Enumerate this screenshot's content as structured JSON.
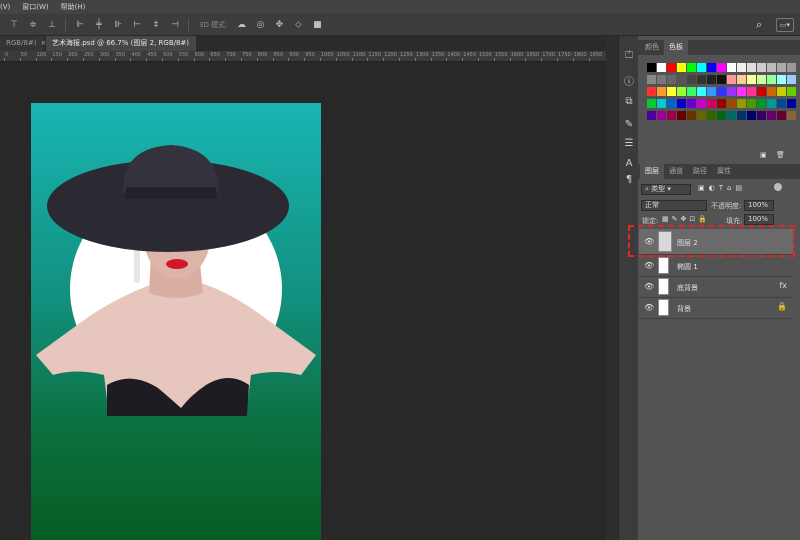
{
  "menu": {
    "items": [
      "(V)",
      "窗口(W)",
      "帮助(H)"
    ]
  },
  "options_bar": {
    "mode_3d_label": "3D 模式:",
    "icons": [
      "align-top-icon",
      "align-vcenter-icon",
      "align-bottom-icon",
      "distribute-top-icon",
      "distribute-vcenter-icon",
      "distribute-bottom-icon",
      "align-left-icon",
      "align-hcenter-icon",
      "align-right-icon",
      "orbit-3d-icon",
      "roll-3d-icon",
      "drag-3d-icon",
      "slide-3d-icon",
      "scale-3d-icon"
    ]
  },
  "tabs": [
    {
      "label": "RGB/8#)",
      "close": "×"
    },
    {
      "label": "艺术海报.psd @ 66.7% (图层 2, RGB/8#) *",
      "close": "×"
    }
  ],
  "ruler": {
    "labels": [
      "0",
      "50",
      "100",
      "150",
      "200",
      "250",
      "300",
      "350",
      "400",
      "450",
      "500",
      "550",
      "600",
      "650",
      "700",
      "750",
      "800",
      "850",
      "900",
      "950",
      "1000",
      "1050",
      "1100",
      "1150",
      "1200",
      "1250",
      "1300",
      "1350",
      "1400",
      "1450",
      "1500",
      "1550",
      "1600",
      "1650",
      "1700",
      "1750",
      "1800",
      "1850"
    ]
  },
  "panels": {
    "color_tabs": [
      "颜色",
      "色板"
    ],
    "layer_tabs": [
      "图层",
      "通道",
      "路径",
      "属性"
    ],
    "filter_kind": "类型",
    "blend_mode": "正常",
    "opacity_label": "不透明度:",
    "opacity_value": "100%",
    "lock_label": "锁定:",
    "fill_label": "填充:",
    "fill_value": "100%"
  },
  "swatch_colors": [
    [
      "#000000",
      "#ffffff",
      "#ff0000",
      "#ffff00",
      "#00ff00",
      "#00ffff",
      "#0000ff",
      "#ff00ff",
      "#ffffff",
      "#eeeeee",
      "#dddddd",
      "#cccccc",
      "#bbbbbb",
      "#aaaaaa",
      "#999999"
    ],
    [
      "#888888",
      "#777777",
      "#666666",
      "#555555",
      "#444444",
      "#333333",
      "#222222",
      "#111111",
      "#ff9999",
      "#ffcc99",
      "#ffff99",
      "#ccff99",
      "#99ff99",
      "#99ffff",
      "#99ccff"
    ],
    [
      "#ff3333",
      "#ff9933",
      "#ffff33",
      "#99ff33",
      "#33ff66",
      "#33ffff",
      "#3399ff",
      "#3333ff",
      "#9933ff",
      "#ff33ff",
      "#ff3399",
      "#cc0000",
      "#cc6600",
      "#cccc00",
      "#66cc00"
    ],
    [
      "#00cc33",
      "#00cccc",
      "#0066cc",
      "#0000cc",
      "#6600cc",
      "#cc00cc",
      "#cc0066",
      "#990000",
      "#994c00",
      "#999900",
      "#4c9900",
      "#009926",
      "#009999",
      "#004c99",
      "#000099"
    ],
    [
      "#4c0099",
      "#990099",
      "#99004c",
      "#660000",
      "#663300",
      "#666600",
      "#336600",
      "#006619",
      "#006666",
      "#003366",
      "#000066",
      "#330066",
      "#660066",
      "#660033",
      "#8c6239"
    ]
  ],
  "layers": [
    {
      "name": "图层 2",
      "right": ""
    },
    {
      "name": "椭圆 1",
      "right": ""
    },
    {
      "name": "底背景",
      "right": "fx"
    },
    {
      "name": "背景",
      "right": "🔒"
    }
  ]
}
